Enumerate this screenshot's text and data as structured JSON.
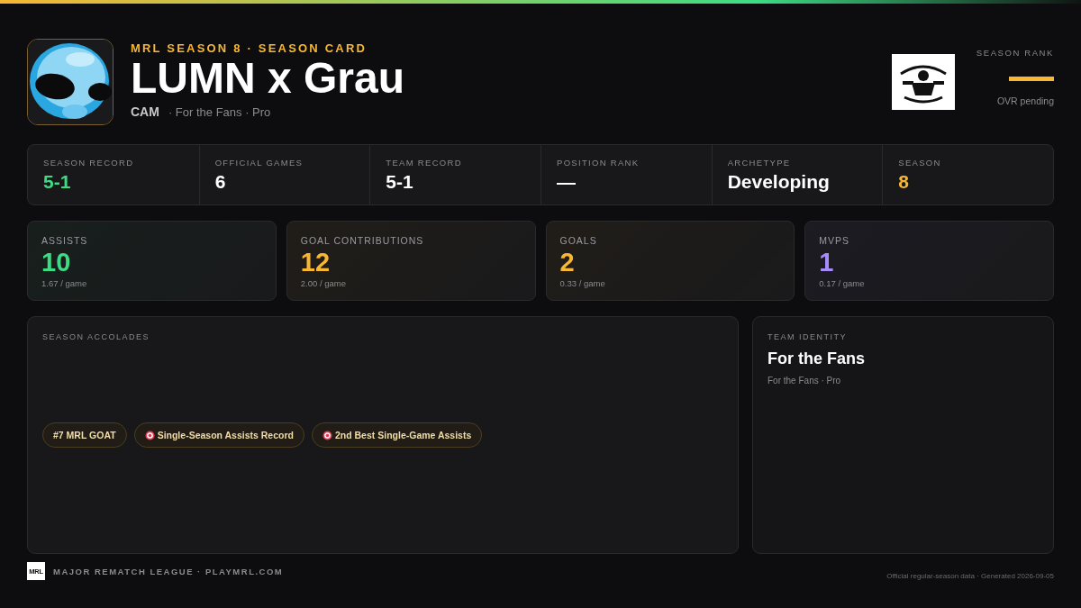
{
  "header": {
    "eyebrow": "MRL SEASON 8 · SEASON CARD",
    "player_name": "LUMN x Grau",
    "position": "CAM",
    "team_line": "· For the Fans · Pro"
  },
  "season_rank": {
    "label": "SEASON RANK",
    "value": "—",
    "note": "OVR pending"
  },
  "stats": [
    {
      "label": "SEASON RECORD",
      "value": "5-1",
      "color": "#3ddc84"
    },
    {
      "label": "OFFICIAL GAMES",
      "value": "6",
      "color": "#ffffff"
    },
    {
      "label": "TEAM RECORD",
      "value": "5-1",
      "color": "#ffffff"
    },
    {
      "label": "POSITION RANK",
      "value": "—",
      "color": "#ffffff"
    },
    {
      "label": "ARCHETYPE",
      "value": "Developing",
      "color": "#ffffff"
    },
    {
      "label": "SEASON",
      "value": "8",
      "color": "#f7b733"
    }
  ],
  "tiles": [
    {
      "label": "ASSISTS",
      "value": "10",
      "rate": "1.67 / game",
      "color": "#3ddc84"
    },
    {
      "label": "GOAL CONTRIBUTIONS",
      "value": "12",
      "rate": "2.00 / game",
      "color": "#f7b733"
    },
    {
      "label": "GOALS",
      "value": "2",
      "rate": "0.33 / game",
      "color": "#f7b733"
    },
    {
      "label": "MVPS",
      "value": "1",
      "rate": "0.17 / game",
      "color": "#a78bfa"
    }
  ],
  "accolades": {
    "title": "SEASON ACCOLADES",
    "badges": [
      {
        "label": "#7 MRL GOAT",
        "target_icon": false
      },
      {
        "label": "Single-Season Assists Record",
        "target_icon": true
      },
      {
        "label": "2nd Best Single-Game Assists",
        "target_icon": true
      }
    ]
  },
  "team_identity": {
    "title": "TEAM IDENTITY",
    "team": "For the Fans",
    "subtitle": "For the Fans · Pro"
  },
  "footer": {
    "logo_text": "MRL",
    "league": "MAJOR REMATCH LEAGUE · PLAYMRL.COM",
    "note": "Official regular-season data · Generated 2026-09-05"
  }
}
